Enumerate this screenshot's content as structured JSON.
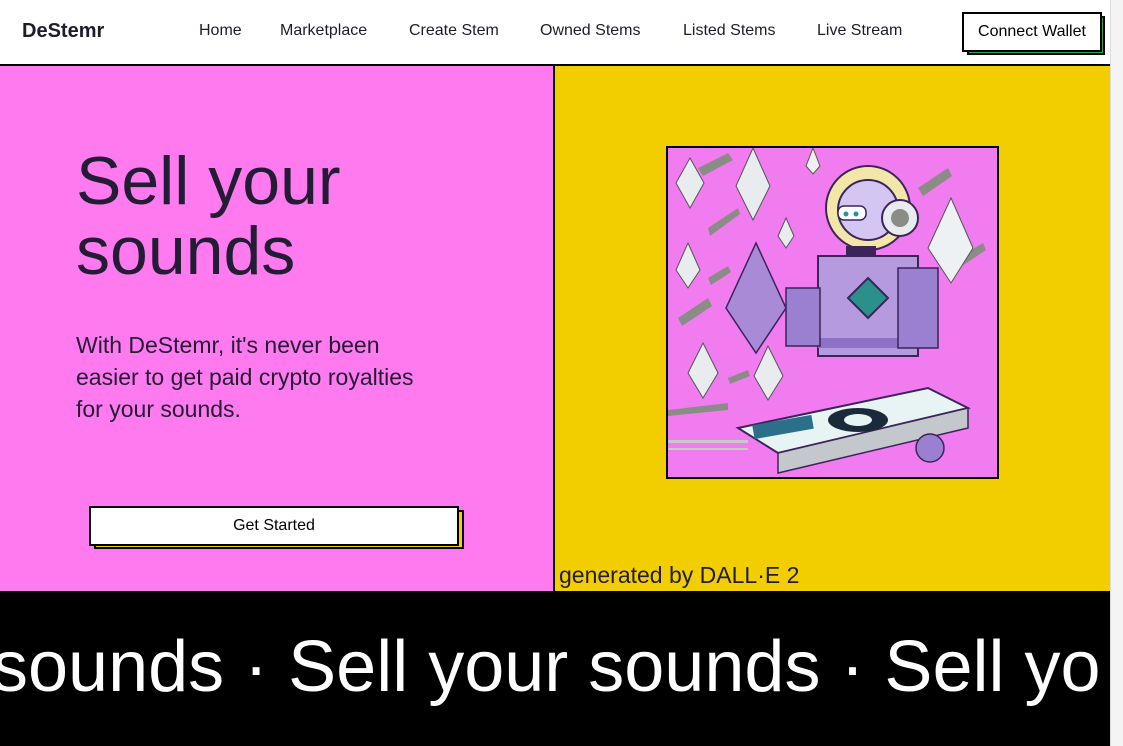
{
  "nav": {
    "brand": "DeStemr",
    "links": [
      "Home",
      "Marketplace",
      "Create Stem",
      "Owned Stems",
      "Listed Stems",
      "Live Stream"
    ],
    "connect_wallet": "Connect Wallet"
  },
  "hero": {
    "title": "Sell your sounds",
    "subtitle": "With DeStemr, it's never been easier to get paid crypto royalties for your sounds.",
    "cta": "Get Started",
    "image_credit": "generated by DALL·E 2"
  },
  "marquee": {
    "text": "r sounds · Sell your sounds · Sell yo"
  },
  "colors": {
    "pink": "#ff79ef",
    "yellow": "#f2cd00",
    "green": "#2fa44a",
    "ink": "#221c35"
  },
  "artwork": {
    "icon": "dj-robot-illustration"
  }
}
